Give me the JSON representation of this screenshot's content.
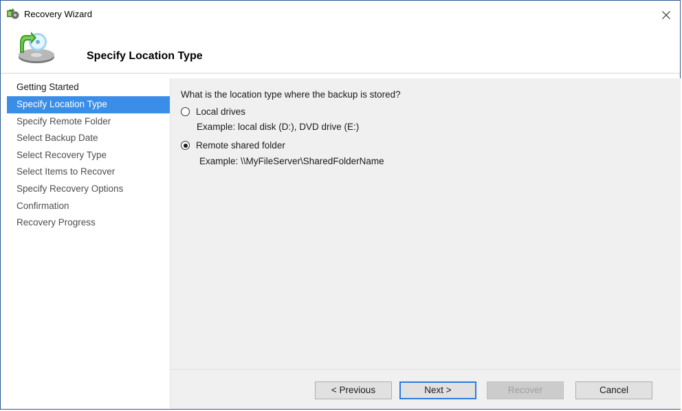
{
  "window": {
    "title": "Recovery Wizard",
    "close_icon": "close-icon",
    "app_icon": "recovery-wizard-icon"
  },
  "header": {
    "title": "Specify Location Type",
    "icon": "backup-disk-restore-icon"
  },
  "nav": {
    "items": [
      {
        "label": "Getting Started"
      },
      {
        "label": "Specify Location Type"
      },
      {
        "label": "Specify Remote Folder"
      },
      {
        "label": "Select Backup Date"
      },
      {
        "label": "Select Recovery Type"
      },
      {
        "label": "Select Items to Recover"
      },
      {
        "label": "Specify Recovery Options"
      },
      {
        "label": "Confirmation"
      },
      {
        "label": "Recovery Progress"
      }
    ],
    "active_index": 1
  },
  "content": {
    "question": "What is the location type where the backup is stored?",
    "options": [
      {
        "label": "Local drives",
        "example": "Example: local disk (D:), DVD drive (E:)",
        "checked": false
      },
      {
        "label": "Remote shared folder",
        "example": "Example: \\\\MyFileServer\\SharedFolderName",
        "checked": true
      }
    ]
  },
  "buttons": {
    "previous": "< Previous",
    "next": "Next >",
    "recover": "Recover",
    "cancel": "Cancel"
  },
  "colors": {
    "accent": "#3b8ee8",
    "border": "#2b5797"
  }
}
